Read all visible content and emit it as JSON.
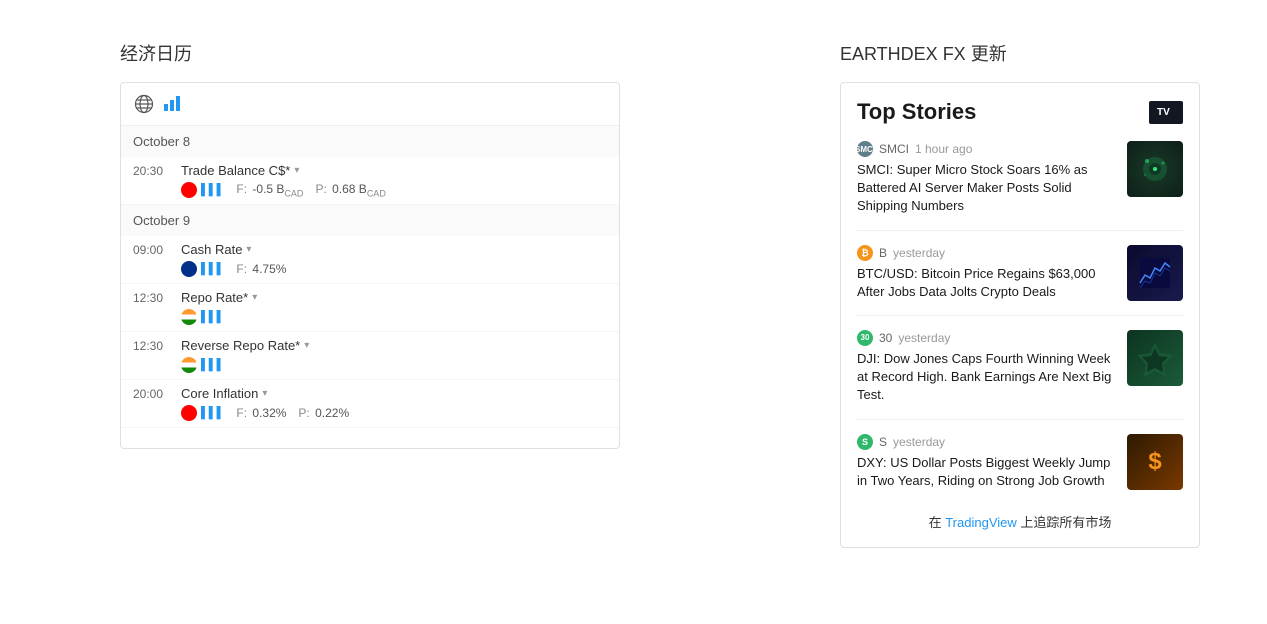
{
  "left": {
    "title": "经济日历",
    "calendar": {
      "date1": {
        "label": "October 8",
        "events": [
          {
            "time": "20:30",
            "name": "Trade Balance C$*",
            "flag": "ca",
            "forecast": "F: -0.5 B",
            "forecast_unit": "CAD",
            "previous": "P: 0.68 B",
            "previous_unit": "CAD"
          }
        ]
      },
      "date2": {
        "label": "October 9",
        "events": [
          {
            "time": "09:00",
            "name": "Cash Rate",
            "flag": "au",
            "forecast": "F: 4.75%",
            "previous": ""
          },
          {
            "time": "12:30",
            "name": "Repo Rate*",
            "flag": "in",
            "forecast": "",
            "previous": ""
          },
          {
            "time": "12:30",
            "name": "Reverse Repo Rate*",
            "flag": "in",
            "forecast": "",
            "previous": ""
          },
          {
            "time": "20:00",
            "name": "Core Inflation",
            "flag": "ca",
            "forecast": "F: 0.32%",
            "previous": "P: 0.22%"
          }
        ]
      }
    }
  },
  "right": {
    "title": "EARTHDEX FX 更新",
    "widget": {
      "heading": "Top Stories",
      "tv_label": "TV",
      "items": [
        {
          "source": "SMCI",
          "source_key": "smci",
          "time": "1 hour ago",
          "text": "SMCI: Super Micro Stock Soars 16% as Battered AI Server Maker Posts Solid Shipping Numbers",
          "thumb_key": "smci"
        },
        {
          "source": "B",
          "source_key": "btc",
          "time": "yesterday",
          "text": "BTC/USD: Bitcoin Price Regains $63,000 After Jobs Data Jolts Crypto Deals",
          "thumb_key": "btc"
        },
        {
          "source": "30",
          "source_key": "dji",
          "time": "yesterday",
          "text": "DJI: Dow Jones Caps Fourth Winning Week at Record High. Bank Earnings Are Next Big Test.",
          "thumb_key": "dji"
        },
        {
          "source": "S",
          "source_key": "dxy",
          "time": "yesterday",
          "text": "DXY: US Dollar Posts Biggest Weekly Jump in Two Years, Riding on Strong Job Growth",
          "thumb_key": "dxy"
        }
      ],
      "footer": "在 TradingView 上追踪所有市场",
      "footer_link": "#"
    }
  }
}
